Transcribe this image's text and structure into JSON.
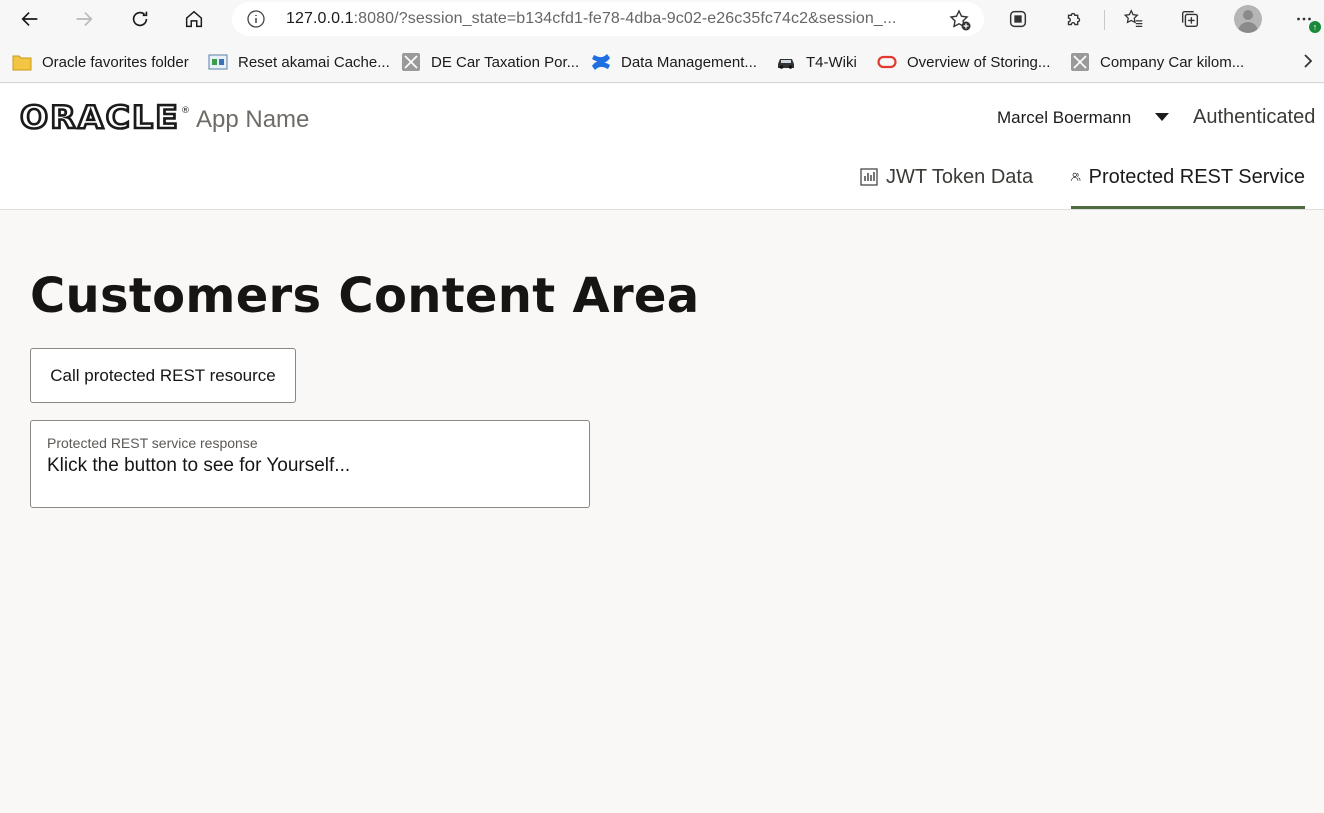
{
  "browser": {
    "url_host": "127.0.0.1",
    "url_rest": ":8080/?session_state=b134cfd1-fe78-4dba-9c02-e26c35fc74c2&session_...",
    "update_badge": "↑"
  },
  "bookmarks": [
    {
      "label": "Oracle favorites folder",
      "icon": "folder-icon"
    },
    {
      "label": "Reset akamai Cache...",
      "icon": "page-icon"
    },
    {
      "label": "DE Car Taxation Por...",
      "icon": "generic-site-icon"
    },
    {
      "label": "Data Management...",
      "icon": "confluence-icon"
    },
    {
      "label": "T4-Wiki",
      "icon": "car-icon"
    },
    {
      "label": "Overview of Storing...",
      "icon": "oracle-icon"
    },
    {
      "label": "Company Car kilom...",
      "icon": "generic-site-icon"
    }
  ],
  "header": {
    "logo": "ORACLE",
    "logo_mark": "®",
    "app_name": "App Name",
    "user_name": "Marcel Boermann",
    "auth_status": "Authenticated",
    "tabs": [
      {
        "label": "JWT Token Data",
        "icon": "bar-chart-icon"
      },
      {
        "label": "Protected REST Service",
        "icon": "users-icon",
        "selected": true
      }
    ]
  },
  "main": {
    "title": "Customers Content Area",
    "call_button_label": "Call protected REST resource",
    "response_label": "Protected REST service response",
    "response_value": "Klick the button to see for Yourself..."
  },
  "colors": {
    "accent_tab_underline": "#4e6b41",
    "page_background": "#f9f8f6"
  }
}
